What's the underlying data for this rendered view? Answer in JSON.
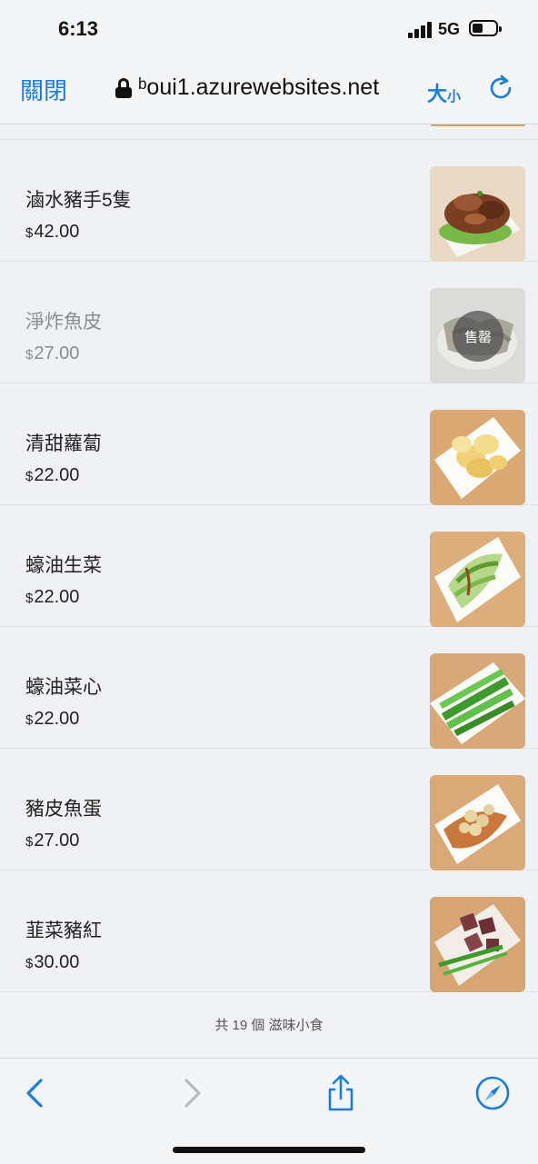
{
  "status": {
    "time": "6:13",
    "network": "5G"
  },
  "browser": {
    "close_label": "關閉",
    "url": "ᵇoui1.azurewebsites.net",
    "text_size_big": "大",
    "text_size_small": "小"
  },
  "items": [
    {
      "name": "滷水豬手5隻",
      "currency": "$",
      "price": "42.00",
      "sold_out": false,
      "sold_label": ""
    },
    {
      "name": "淨炸魚皮",
      "currency": "$",
      "price": "27.00",
      "sold_out": true,
      "sold_label": "售罄"
    },
    {
      "name": "清甜蘿蔔",
      "currency": "$",
      "price": "22.00",
      "sold_out": false,
      "sold_label": ""
    },
    {
      "name": "蠔油生菜",
      "currency": "$",
      "price": "22.00",
      "sold_out": false,
      "sold_label": ""
    },
    {
      "name": "蠔油菜心",
      "currency": "$",
      "price": "22.00",
      "sold_out": false,
      "sold_label": ""
    },
    {
      "name": "豬皮魚蛋",
      "currency": "$",
      "price": "27.00",
      "sold_out": false,
      "sold_label": ""
    },
    {
      "name": "韮菜豬紅",
      "currency": "$",
      "price": "30.00",
      "sold_out": false,
      "sold_label": ""
    }
  ],
  "footer": {
    "count_text": "共 19 個 滋味小食"
  },
  "icons": {
    "back": "chevron-left-icon",
    "forward": "chevron-right-icon",
    "share": "share-icon",
    "compass": "compass-icon",
    "reload": "reload-icon",
    "lock": "lock-icon"
  },
  "colors": {
    "accent": "#1a7ce0",
    "disabled": "#b8bcc2"
  }
}
